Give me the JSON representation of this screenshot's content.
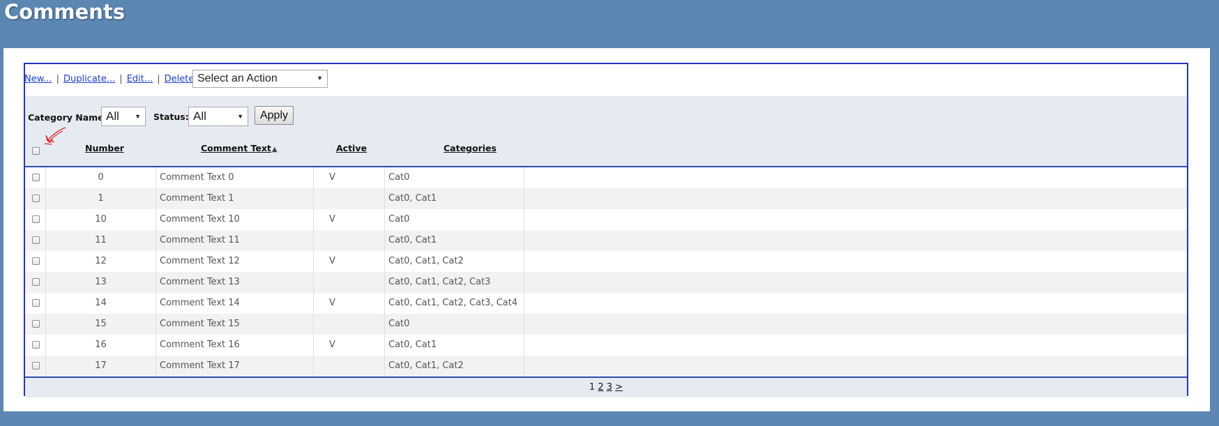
{
  "page": {
    "title": "Comments"
  },
  "toolbar": {
    "links": [
      {
        "label": "New..."
      },
      {
        "label": "Duplicate..."
      },
      {
        "label": "Edit..."
      },
      {
        "label": "Delete"
      }
    ],
    "separator": "|",
    "action_select": {
      "value": "Select an Action"
    }
  },
  "filters": {
    "category_label": "Category Name:",
    "category_value": "All",
    "status_label": "Status:",
    "status_value": "All",
    "apply_label": "Apply"
  },
  "columns": {
    "number": "Number",
    "comment_text": "Comment Text",
    "sort_indicator": "▲",
    "active": "Active",
    "categories": "Categories"
  },
  "rows": [
    {
      "number": "0",
      "text": "Comment Text 0",
      "active": "V",
      "categories": "Cat0"
    },
    {
      "number": "1",
      "text": "Comment Text 1",
      "active": "",
      "categories": "Cat0, Cat1"
    },
    {
      "number": "10",
      "text": "Comment Text 10",
      "active": "V",
      "categories": "Cat0"
    },
    {
      "number": "11",
      "text": "Comment Text 11",
      "active": "",
      "categories": "Cat0, Cat1"
    },
    {
      "number": "12",
      "text": "Comment Text 12",
      "active": "V",
      "categories": "Cat0, Cat1, Cat2"
    },
    {
      "number": "13",
      "text": "Comment Text 13",
      "active": "",
      "categories": "Cat0, Cat1, Cat2, Cat3"
    },
    {
      "number": "14",
      "text": "Comment Text 14",
      "active": "V",
      "categories": "Cat0, Cat1, Cat2, Cat3, Cat4"
    },
    {
      "number": "15",
      "text": "Comment Text 15",
      "active": "",
      "categories": "Cat0"
    },
    {
      "number": "16",
      "text": "Comment Text 16",
      "active": "V",
      "categories": "Cat0, Cat1"
    },
    {
      "number": "17",
      "text": "Comment Text 17",
      "active": "",
      "categories": "Cat0, Cat1, Cat2"
    }
  ],
  "pager": {
    "current": "1",
    "pages": [
      "2",
      "3"
    ],
    "next": ">"
  },
  "colors": {
    "background": "#5c87b3",
    "border": "#2234c7",
    "link": "#1a3ed8",
    "header_bg": "#e6ebf2",
    "annotation_arrow": "#e0232a"
  }
}
